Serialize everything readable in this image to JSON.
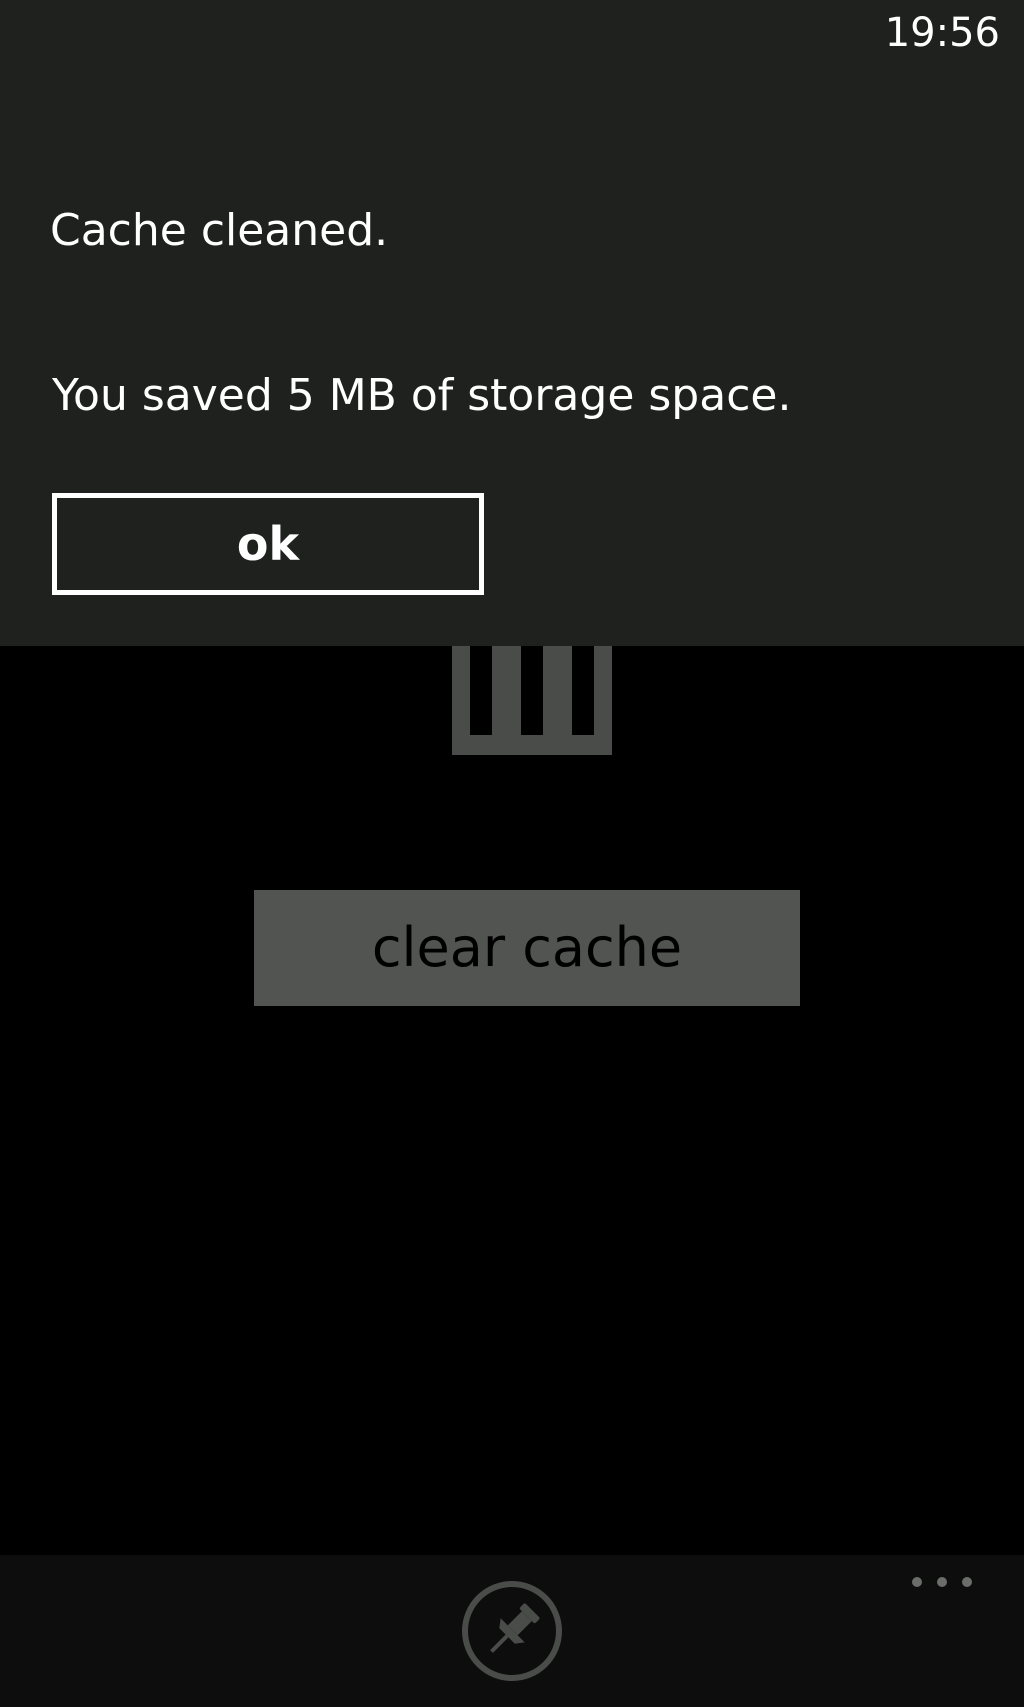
{
  "status_bar": {
    "time": "19:56"
  },
  "dialog": {
    "title": "Cache cleaned.",
    "message": "You saved 5 MB of storage space.",
    "ok_label": "ok"
  },
  "main": {
    "clear_cache_label": "clear cache",
    "icon": "trash-can-icon"
  },
  "app_bar": {
    "pin_icon": "pin-icon",
    "more_icon": "more-options-icon"
  },
  "colors": {
    "dialog_background": "#1f211f",
    "page_background": "#000000",
    "button_disabled": "#525452",
    "icon_dimmed": "#4a4c4a"
  }
}
